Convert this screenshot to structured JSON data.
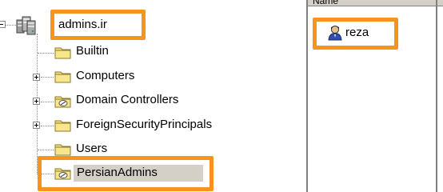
{
  "tree": {
    "root": {
      "label": "admins.ir",
      "icon": "domain-server-icon"
    },
    "items": [
      {
        "label": "Builtin",
        "icon": "folder-icon",
        "expandable": false
      },
      {
        "label": "Computers",
        "icon": "folder-icon",
        "expandable": true
      },
      {
        "label": "Domain Controllers",
        "icon": "ou-folder-icon",
        "expandable": true
      },
      {
        "label": "ForeignSecurityPrincipals",
        "icon": "folder-icon",
        "expandable": true
      },
      {
        "label": "Users",
        "icon": "folder-icon",
        "expandable": false
      },
      {
        "label": "PersianAdmins",
        "icon": "ou-folder-icon",
        "expandable": false,
        "selected": true
      }
    ]
  },
  "list_pane": {
    "column_header": "Name",
    "items": [
      {
        "label": "reza",
        "icon": "user-icon"
      }
    ]
  },
  "colors": {
    "highlight": "#f7941d",
    "folder_yellow": "#f6e07a",
    "selection_bg": "#d4d0c8"
  }
}
